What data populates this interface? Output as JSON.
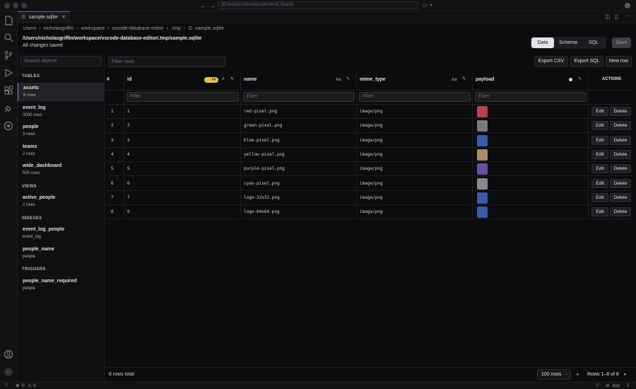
{
  "titlebar": {
    "search": "[Extension Development Host] Search"
  },
  "tab": {
    "label": "sample.sqlite",
    "close": "✕"
  },
  "breadcrumb": [
    "Users",
    "nicholasgriffin",
    "workspace",
    "vscode-database-editor",
    ".tmp",
    "sample.sqlite"
  ],
  "header": {
    "path": "/Users/nicholasgriffin/workspace/vscode-database-editor/.tmp/sample.sqlite",
    "status": "All changes saved",
    "modes": [
      "Data",
      "Schema",
      "SQL"
    ],
    "active_mode": "Data",
    "save_label": "Save"
  },
  "sidebar": {
    "search_placeholder": "Search objects",
    "tables_head": "TABLES",
    "tables": [
      {
        "name": "assets",
        "sub": "8 rows"
      },
      {
        "name": "event_log",
        "sub": "3000 rows"
      },
      {
        "name": "people",
        "sub": "3 rows"
      },
      {
        "name": "teams",
        "sub": "2 rows"
      },
      {
        "name": "wide_dashboard",
        "sub": "500 rows"
      }
    ],
    "views_head": "VIEWS",
    "views": [
      {
        "name": "active_people",
        "sub": "2 rows"
      }
    ],
    "indexes_head": "INDEXES",
    "indexes": [
      {
        "name": "event_log_people",
        "sub": "event_log"
      },
      {
        "name": "people_name",
        "sub": "people"
      }
    ],
    "triggers_head": "TRIGGERS",
    "triggers": [
      {
        "name": "people_name_required",
        "sub": "people"
      }
    ]
  },
  "toolbar": {
    "filter_placeholder": "Filter rows",
    "export_csv": "Export CSV",
    "export_sql": "Export SQL",
    "new_row": "New row"
  },
  "grid": {
    "columns": {
      "num": "#",
      "id": "id",
      "name": "name",
      "mime_type": "mime_type",
      "payload": "payload",
      "actions": "ACTIONS"
    },
    "pk_badge": "🔑 PK",
    "id_type_icon": "#",
    "text_type_icon": "Aa",
    "filter_placeholder": "Filter",
    "rows": [
      {
        "n": "1",
        "id": "1",
        "name": "red-pixel.png",
        "mime": "image/png",
        "color": "#b8424c"
      },
      {
        "n": "2",
        "id": "2",
        "name": "green-pixel.png",
        "mime": "image/png",
        "color": "#7a7a7e"
      },
      {
        "n": "3",
        "id": "3",
        "name": "blue-pixel.png",
        "mime": "image/png",
        "color": "#3c5aa8"
      },
      {
        "n": "4",
        "id": "4",
        "name": "yellow-pixel.png",
        "mime": "image/png",
        "color": "#a88d6a"
      },
      {
        "n": "5",
        "id": "5",
        "name": "purple-pixel.png",
        "mime": "image/png",
        "color": "#6b4fa0"
      },
      {
        "n": "6",
        "id": "6",
        "name": "cyan-pixel.png",
        "mime": "image/png",
        "color": "#8a8a8e"
      },
      {
        "n": "7",
        "id": "7",
        "name": "logo-32x32.png",
        "mime": "image/png",
        "color": "#3c5aa8"
      },
      {
        "n": "8",
        "id": "8",
        "name": "logo-64x64.png",
        "mime": "image/png",
        "color": "#3c5aa8"
      }
    ],
    "edit_label": "Edit",
    "delete_label": "Delete"
  },
  "footer": {
    "total": "8 rows total",
    "page_size": "100 rows",
    "range": "Rows 1–8 of 8"
  },
  "statusbar": {
    "errors": "0",
    "warnings": "0",
    "right_label": "dxc"
  }
}
